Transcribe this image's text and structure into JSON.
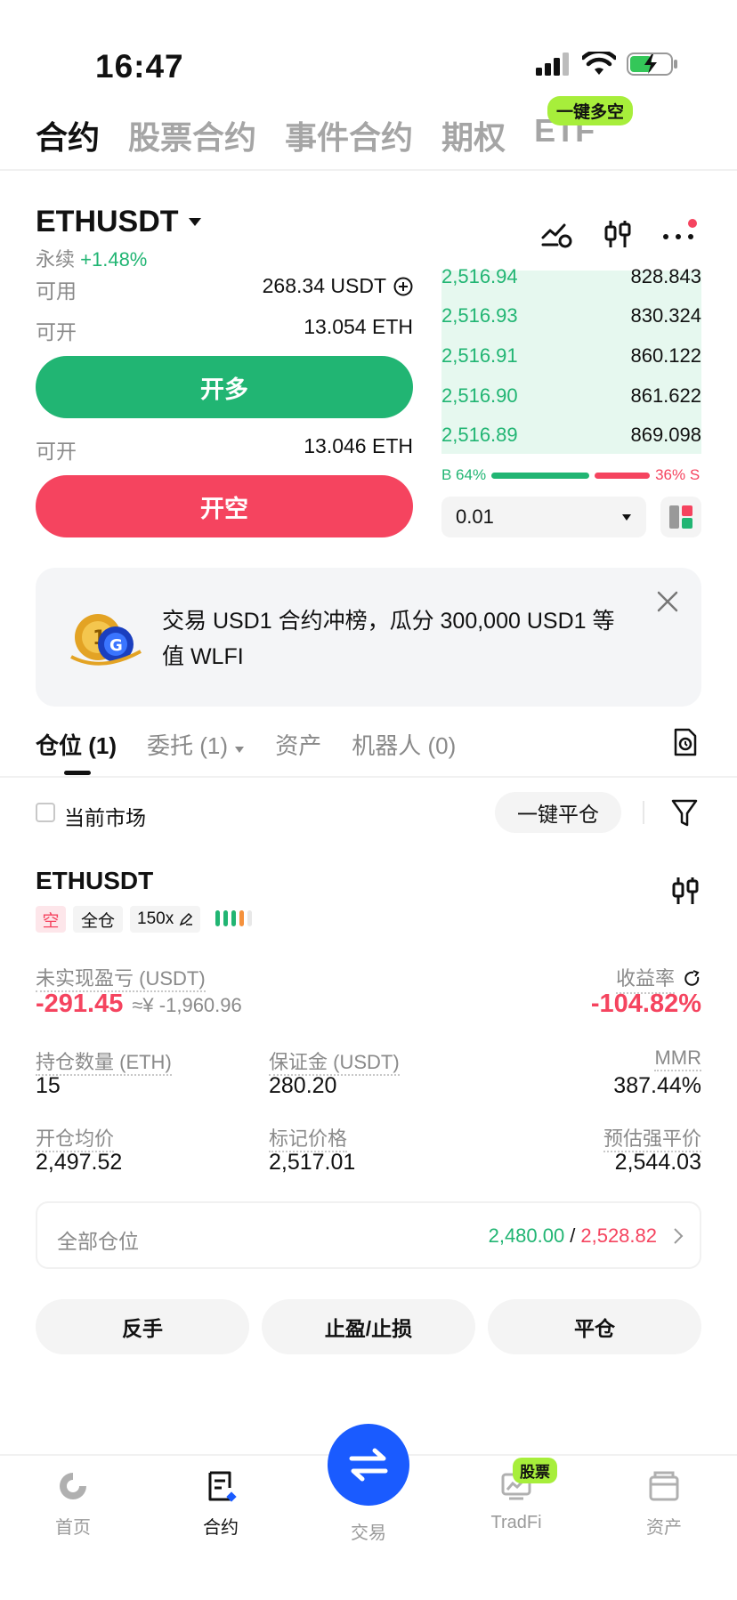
{
  "status_bar": {
    "time": "16:47"
  },
  "top_tabs": [
    {
      "label": "合约",
      "active": true
    },
    {
      "label": "股票合约",
      "active": false
    },
    {
      "label": "事件合约",
      "active": false
    },
    {
      "label": "期权",
      "active": false
    },
    {
      "label": "ETF",
      "active": false
    }
  ],
  "etf_badge": "一键多空",
  "header": {
    "symbol": "ETHUSDT",
    "type": "永续",
    "change": "+1.48%"
  },
  "trade": {
    "available_label": "可用",
    "available_value": "268.34 USDT",
    "open_long_label": "可开",
    "open_long_value": "13.054 ETH",
    "long_button": "开多",
    "open_short_label": "可开",
    "open_short_value": "13.046 ETH",
    "short_button": "开空"
  },
  "order_book": {
    "rows": [
      {
        "price": "2,516.94",
        "qty": "828.843"
      },
      {
        "price": "2,516.93",
        "qty": "830.324"
      },
      {
        "price": "2,516.91",
        "qty": "860.122"
      },
      {
        "price": "2,516.90",
        "qty": "861.622"
      },
      {
        "price": "2,516.89",
        "qty": "869.098"
      }
    ],
    "buy_ratio": "B 64%",
    "sell_ratio": "36% S",
    "buy_fraction": 0.64,
    "depth": "0.01"
  },
  "banner": {
    "text": "交易 USD1 合约冲榜，瓜分 300,000 USD1 等值 WLFI"
  },
  "position_tabs": [
    {
      "label": "仓位 (1)",
      "active": true
    },
    {
      "label": "委托 (1)",
      "active": false
    },
    {
      "label": "资产",
      "active": false
    },
    {
      "label": "机器人 (0)",
      "active": false
    }
  ],
  "filter": {
    "current_market": "当前市场",
    "close_all": "一键平仓"
  },
  "position": {
    "symbol": "ETHUSDT",
    "side": "空",
    "margin_mode": "全仓",
    "leverage": "150x",
    "unrealized_label": "未实现盈亏 (USDT)",
    "unrealized_value": "-291.45",
    "unrealized_cny": "≈¥ -1,960.96",
    "roi_label": "收益率",
    "roi_value": "-104.82%",
    "size_label": "持仓数量 (ETH)",
    "size_value": "15",
    "margin_label": "保证金 (USDT)",
    "margin_value": "280.20",
    "mmr_label": "MMR",
    "mmr_value": "387.44%",
    "entry_label": "开仓均价",
    "entry_value": "2,497.52",
    "mark_label": "标记价格",
    "mark_value": "2,517.01",
    "liq_label": "预估强平价",
    "liq_value": "2,544.03",
    "all_positions_label": "全部仓位",
    "range_low": "2,480.00",
    "range_sep": "/",
    "range_high": "2,528.82"
  },
  "actions": {
    "reverse": "反手",
    "tpsl": "止盈/止损",
    "close": "平仓"
  },
  "bottom_nav": [
    {
      "label": "首页",
      "active": false
    },
    {
      "label": "合约",
      "active": true
    },
    {
      "label": "交易",
      "active": false
    },
    {
      "label": "TradFi",
      "active": false
    },
    {
      "label": "资产",
      "active": false
    }
  ],
  "stock_badge": "股票",
  "colors": {
    "green": "#21b573",
    "red": "#f5445f",
    "orange": "#f5913c",
    "blue": "#1a5bff",
    "lime": "#a7ee3b"
  }
}
